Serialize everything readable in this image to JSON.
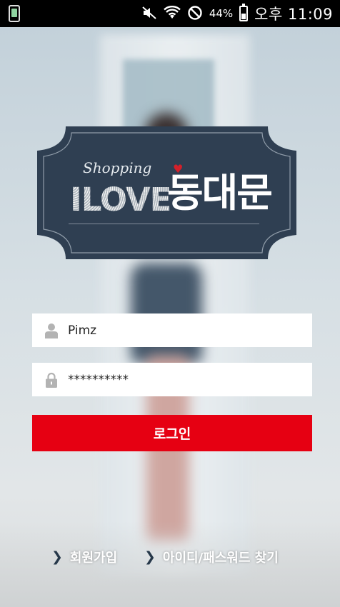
{
  "status_bar": {
    "battery_percent": "44%",
    "time": "오후 11:09",
    "icons": [
      "phone-icon",
      "mute-icon",
      "wifi-icon",
      "blocked-icon",
      "battery-icon"
    ]
  },
  "logo": {
    "shopping": "Shopping",
    "ilove": "ILOVE",
    "brand": "동대문",
    "colors": {
      "badge": "#2f3f52",
      "heart": "#d3202a"
    }
  },
  "form": {
    "username_value": "Pimz",
    "password_value": "**********",
    "login_label": "로그인",
    "colors": {
      "button": "#e60012"
    }
  },
  "links": {
    "signup": "회원가입",
    "find_account": "아이디/패스워드 찾기"
  }
}
